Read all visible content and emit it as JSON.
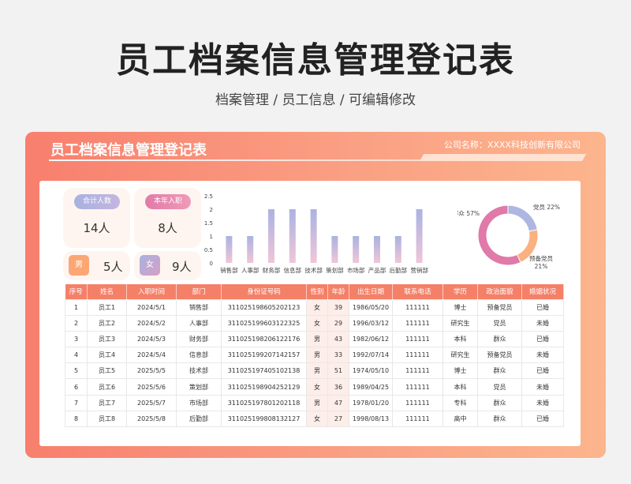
{
  "page": {
    "title": "员工档案信息管理登记表",
    "subtitle": "档案管理 / 员工信息 /  可编辑修改"
  },
  "card": {
    "title": "员工档案信息管理登记表",
    "company": "公司名称：XXXX科技创新有限公司"
  },
  "stats": {
    "total_label": "合计人数",
    "total_value": "14人",
    "new_label": "本年入职",
    "new_value": "8人",
    "male_label": "男",
    "male_value": "5人",
    "female_label": "女",
    "female_value": "9人"
  },
  "colors": {
    "accent": "#f58068",
    "bar_top": "#aab2e2",
    "bar_bottom": "#f0c6d8",
    "donut_party": "#aeb6e2",
    "donut_prep": "#fbb080",
    "donut_masses": "#e07aa8"
  },
  "chart_data": [
    {
      "type": "bar",
      "categories": [
        "销售部",
        "人事部",
        "财务部",
        "信息部",
        "技术部",
        "策划部",
        "市场部",
        "产品部",
        "后勤部",
        "营销部"
      ],
      "values": [
        1,
        1,
        2,
        2,
        2,
        1,
        1,
        1,
        1,
        2
      ],
      "ylim": [
        0,
        2.5
      ],
      "yticks": [
        "0",
        "0.5",
        "1",
        "1.5",
        "2",
        "2.5"
      ],
      "grid": false
    },
    {
      "type": "pie",
      "categories": [
        "党员",
        "预备党员",
        "群众"
      ],
      "values": [
        22,
        21,
        57
      ],
      "labels": [
        "党员 22%",
        "预备党员 21%",
        "群众 57%"
      ]
    }
  ],
  "table": {
    "headers": [
      "序号",
      "姓名",
      "入职时间",
      "部门",
      "身份证号码",
      "性别",
      "年龄",
      "出生日期",
      "联系电话",
      "学历",
      "政治面貌",
      "婚姻状况"
    ],
    "rows": [
      [
        "1",
        "员工1",
        "2024/5/1",
        "销售部",
        "311025198605202123",
        "女",
        "39",
        "1986/05/20",
        "111111",
        "博士",
        "预备党员",
        "已婚"
      ],
      [
        "2",
        "员工2",
        "2024/5/2",
        "人事部",
        "311025199603122325",
        "女",
        "29",
        "1996/03/12",
        "111111",
        "研究生",
        "党员",
        "未婚"
      ],
      [
        "3",
        "员工3",
        "2024/5/3",
        "财务部",
        "311025198206122176",
        "男",
        "43",
        "1982/06/12",
        "111111",
        "本科",
        "群众",
        "已婚"
      ],
      [
        "4",
        "员工4",
        "2024/5/4",
        "信息部",
        "311025199207142157",
        "男",
        "33",
        "1992/07/14",
        "111111",
        "研究生",
        "预备党员",
        "未婚"
      ],
      [
        "5",
        "员工5",
        "2025/5/5",
        "技术部",
        "311025197405102138",
        "男",
        "51",
        "1974/05/10",
        "111111",
        "博士",
        "群众",
        "已婚"
      ],
      [
        "6",
        "员工6",
        "2025/5/6",
        "策划部",
        "311025198904252129",
        "女",
        "36",
        "1989/04/25",
        "111111",
        "本科",
        "党员",
        "未婚"
      ],
      [
        "7",
        "员工7",
        "2025/5/7",
        "市场部",
        "311025197801202118",
        "男",
        "47",
        "1978/01/20",
        "111111",
        "专科",
        "群众",
        "未婚"
      ],
      [
        "8",
        "员工8",
        "2025/5/8",
        "后勤部",
        "311025199808132127",
        "女",
        "27",
        "1998/08/13",
        "111111",
        "高中",
        "群众",
        "已婚"
      ]
    ]
  }
}
